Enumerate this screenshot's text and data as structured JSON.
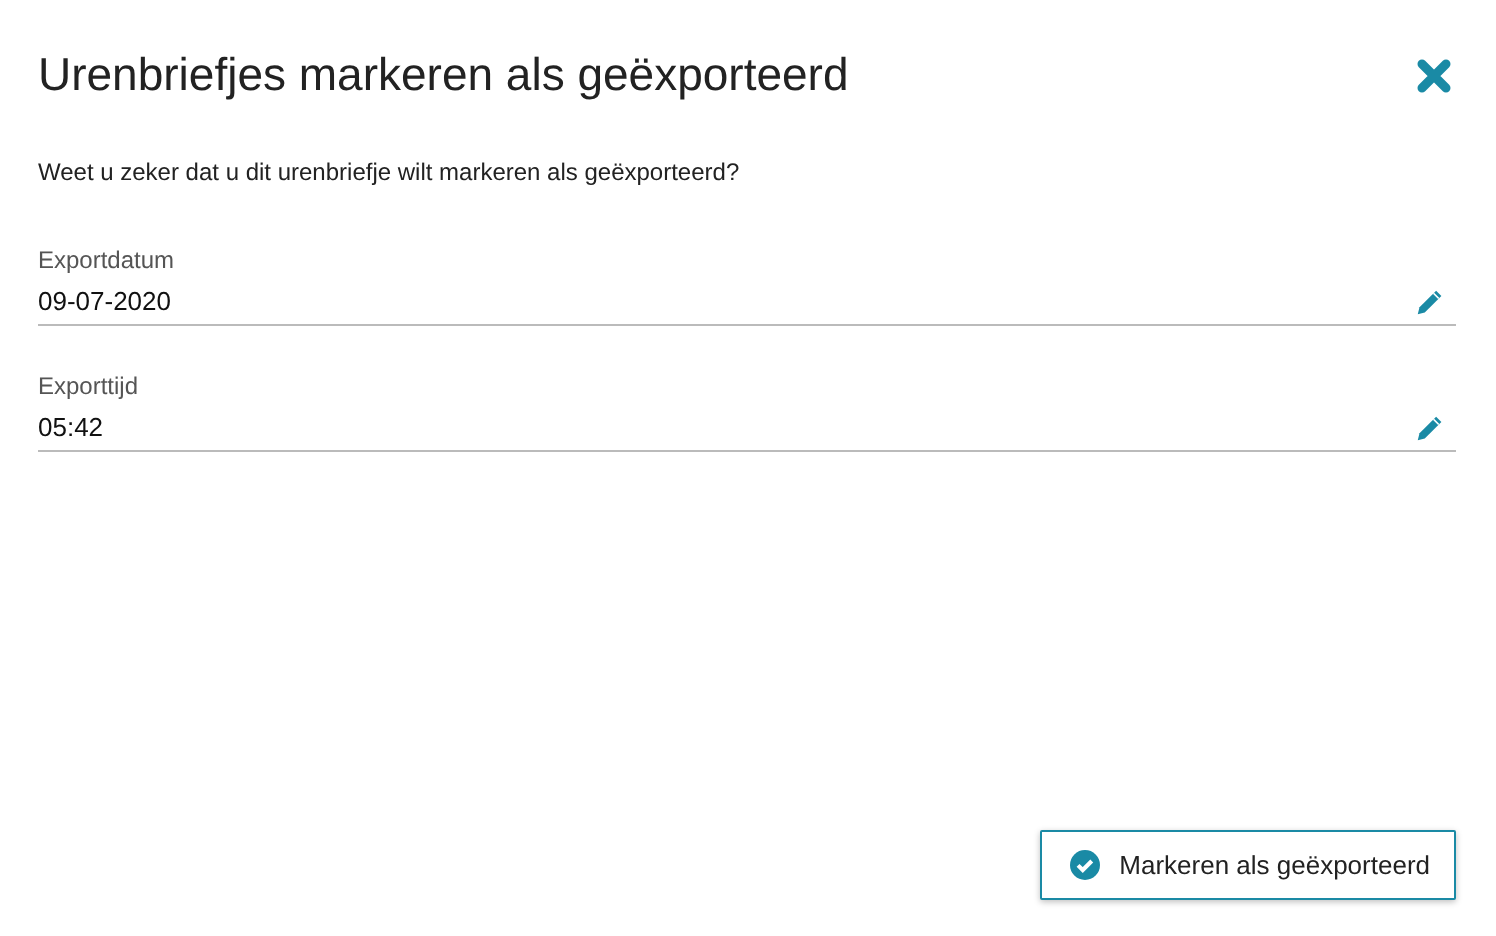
{
  "dialog": {
    "title": "Urenbriefjes markeren als geëxporteerd",
    "message": "Weet u zeker dat u dit urenbriefje wilt markeren als geëxporteerd?",
    "fields": [
      {
        "label": "Exportdatum",
        "value": "09-07-2020"
      },
      {
        "label": "Exporttijd",
        "value": "05:42"
      }
    ],
    "confirm_button": "Markeren als geëxporteerd"
  }
}
